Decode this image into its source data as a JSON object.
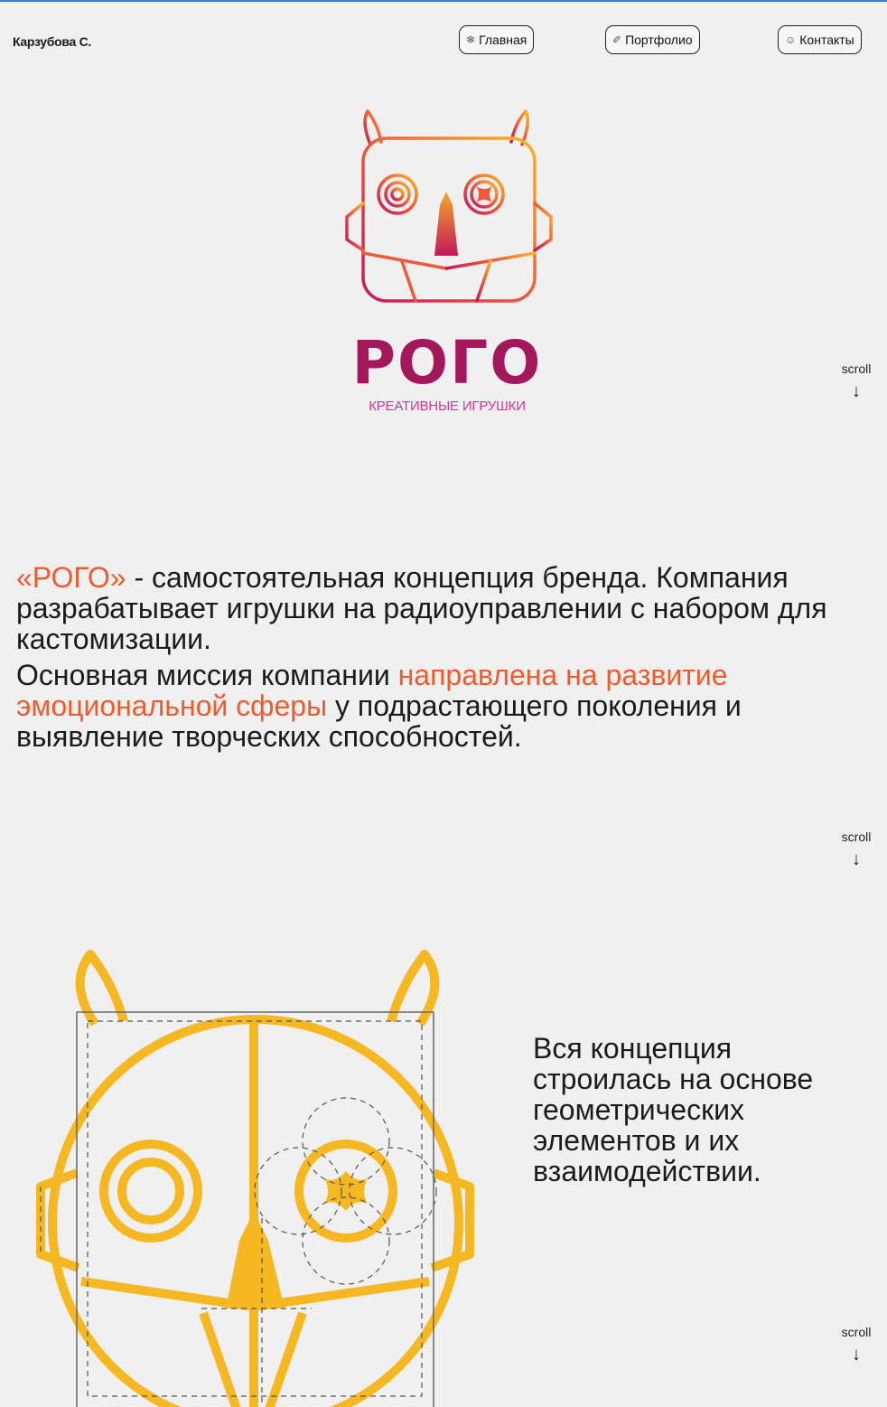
{
  "header": {
    "author": "Карзубова С.",
    "nav": [
      {
        "label": "Главная",
        "icon": "snowflake-icon",
        "glyph": "❄"
      },
      {
        "label": "Портфолио",
        "icon": "brush-icon",
        "glyph": "✐"
      },
      {
        "label": "Контакты",
        "icon": "smile-icon",
        "glyph": "☺"
      }
    ]
  },
  "logo": {
    "word": "РОГО",
    "tagline": "КРЕАТИВНЫЕ ИГРУШКИ",
    "colors": {
      "gradient_start": "#c2185b",
      "gradient_end": "#fbb526",
      "word": "#a3185a"
    }
  },
  "scroll_label": "scroll",
  "intro": {
    "p1_brand": "«РОГО»",
    "p1_rest": " - самостоятельная концепция бренда. Компания разрабатывает игрушки на радиоуправлении с набором для кастомизации.",
    "p2_start": "Основная миссия компании ",
    "p2_highlight": "направлена на развитие эмоциональной сферы",
    "p2_end": " у подрастающего поколения и выявление творческих способностей."
  },
  "concept_text": "Вся концепция строилась на основе геометрических элементов и их взаимодействии.",
  "colors": {
    "accent": "#f25a2c",
    "sketch": "#f5b823",
    "text": "#1b1b1b",
    "background": "#f0f0f0"
  }
}
